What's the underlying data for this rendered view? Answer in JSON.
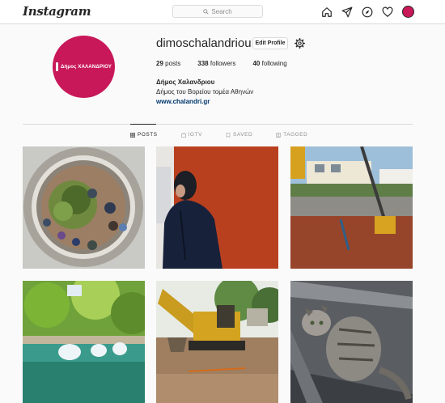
{
  "header": {
    "logo_text": "Instagram",
    "search_placeholder": "Search",
    "icons": [
      "home-icon",
      "direct-icon",
      "explore-icon",
      "heart-icon",
      "avatar"
    ]
  },
  "profile": {
    "avatar_text": "Δήμος ΧΑΛΑΝΔΡΙΟΥ",
    "username": "dimoschalandriou",
    "edit_label": "Edit Profile",
    "stats": [
      {
        "count": "29",
        "label": "posts"
      },
      {
        "count": "338",
        "label": "followers"
      },
      {
        "count": "40",
        "label": "following"
      }
    ],
    "full_name": "Δήμος Χαλανδριου",
    "bio": "Δήμος του Βορείου τομέα Αθηνών",
    "website": "www.chalandri.gr"
  },
  "tabs": [
    {
      "label": "POSTS",
      "icon": "grid-icon",
      "active": true
    },
    {
      "label": "IGTV",
      "icon": "tv-icon",
      "active": false
    },
    {
      "label": "SAVED",
      "icon": "bookmark-icon",
      "active": false
    },
    {
      "label": "TAGGED",
      "icon": "tag-icon",
      "active": false
    }
  ],
  "colors": {
    "brand": "#c8185a",
    "link": "#00376b",
    "border": "#dbdbdb"
  }
}
